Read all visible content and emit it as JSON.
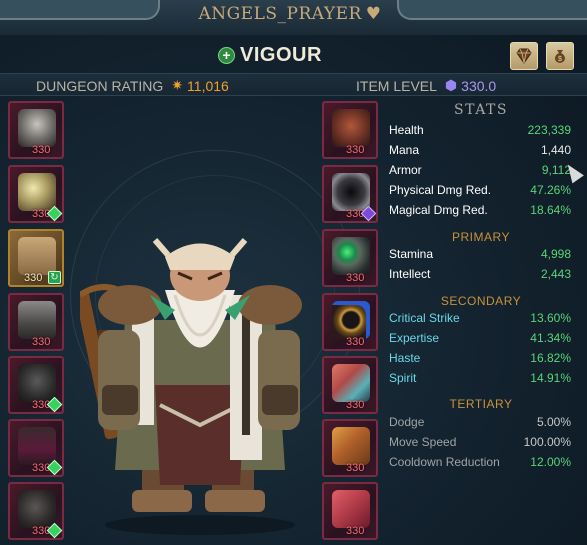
{
  "header": {
    "character_name": "ANGELS_PRAYER",
    "spec_name": "VIGOUR"
  },
  "ratings": {
    "dungeon_rating_label": "DUNGEON RATING",
    "dungeon_rating_value": "11,016",
    "item_level_label": "ITEM LEVEL",
    "item_level_value": "330.0"
  },
  "equipment": {
    "left": [
      {
        "level": "330",
        "item": "helm",
        "gem": "none"
      },
      {
        "level": "330",
        "item": "shoulders",
        "gem": "green"
      },
      {
        "level": "330",
        "item": "cloak",
        "gem": "green-square"
      },
      {
        "level": "330",
        "item": "chest",
        "gem": "none"
      },
      {
        "level": "330",
        "item": "gloves",
        "gem": "green"
      },
      {
        "level": "330",
        "item": "legs",
        "gem": "green"
      },
      {
        "level": "330",
        "item": "boots",
        "gem": "green"
      }
    ],
    "right": [
      {
        "level": "330",
        "item": "amulet",
        "gem": "none"
      },
      {
        "level": "330",
        "item": "bracers",
        "gem": "violet"
      },
      {
        "level": "330",
        "item": "ring-emerald",
        "gem": "none"
      },
      {
        "level": "330",
        "item": "ring-sapphire",
        "gem": "none"
      },
      {
        "level": "330",
        "item": "trinket-crystal",
        "gem": "none"
      },
      {
        "level": "330",
        "item": "tome-orange",
        "gem": "none"
      },
      {
        "level": "330",
        "item": "tome-pink",
        "gem": "none"
      }
    ]
  },
  "stats": {
    "title": "STATS",
    "base": [
      {
        "label": "Health",
        "value": "223,339"
      },
      {
        "label": "Mana",
        "value": "1,440"
      },
      {
        "label": "Armor",
        "value": "9,112"
      },
      {
        "label": "Physical Dmg Red.",
        "value": "47.26%"
      },
      {
        "label": "Magical Dmg Red.",
        "value": "18.64%"
      }
    ],
    "primary_title": "PRIMARY",
    "primary": [
      {
        "label": "Stamina",
        "value": "4,998"
      },
      {
        "label": "Intellect",
        "value": "2,443"
      }
    ],
    "secondary_title": "SECONDARY",
    "secondary": [
      {
        "label": "Critical Strike",
        "value": "13.60%"
      },
      {
        "label": "Expertise",
        "value": "41.34%"
      },
      {
        "label": "Haste",
        "value": "16.82%"
      },
      {
        "label": "Spirit",
        "value": "14.91%"
      }
    ],
    "tertiary_title": "TERTIARY",
    "tertiary": [
      {
        "label": "Dodge",
        "value": "5.00%"
      },
      {
        "label": "Move Speed",
        "value": "100.00%"
      },
      {
        "label": "Cooldown Reduction",
        "value": "12.00%"
      }
    ]
  },
  "colors": {
    "accent_gold": "#c9a97a",
    "stat_green": "#5ad478",
    "secondary_cyan": "#6ad8e8",
    "section_orange": "#c8923a",
    "slot_border": "#7a2a42",
    "item_level_pink": "#ff6a78"
  },
  "icons": {
    "name_suffix": "heart-icon",
    "spec": "plus-icon",
    "btn_1": "gem-emblem-icon",
    "btn_2": "money-bag-icon",
    "rating": "rating-gem-icon",
    "item_level": "item-level-gem-icon"
  }
}
